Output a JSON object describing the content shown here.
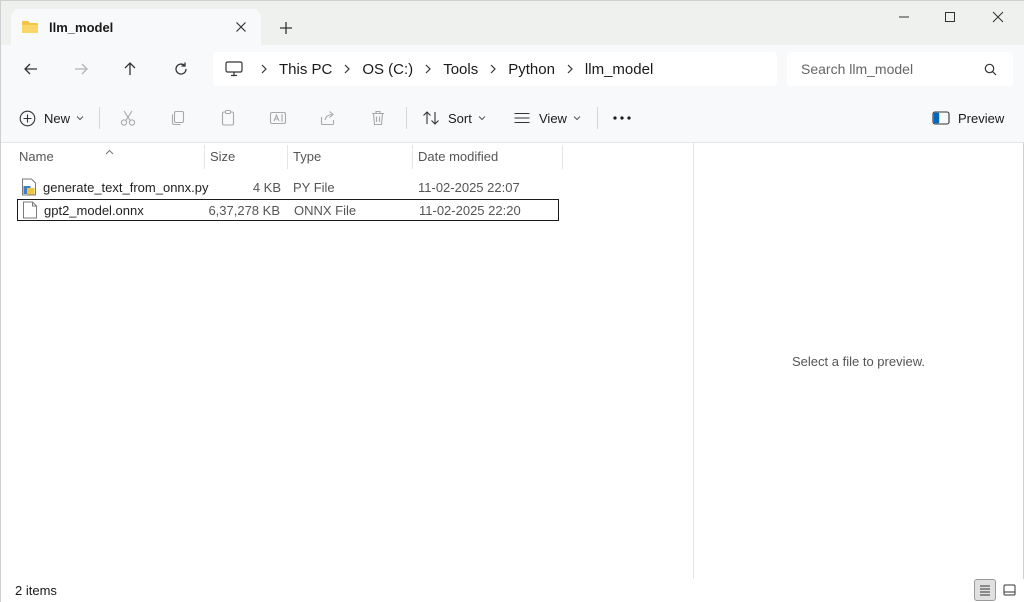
{
  "tab": {
    "title": "llm_model",
    "folder_color": "#f4c542"
  },
  "window_controls": [
    "minimize",
    "maximize",
    "close"
  ],
  "breadcrumb": [
    "This PC",
    "OS (C:)",
    "Tools",
    "Python",
    "llm_model"
  ],
  "search": {
    "placeholder": "Search llm_model"
  },
  "toolbar": {
    "new_label": "New",
    "sort_label": "Sort",
    "view_label": "View",
    "preview_label": "Preview"
  },
  "columns": {
    "name": "Name",
    "size": "Size",
    "type": "Type",
    "date": "Date modified"
  },
  "files": [
    {
      "name": "generate_text_from_onnx.py",
      "size": "4 KB",
      "type": "PY File",
      "date": "11-02-2025 22:07",
      "icon": "python-file-icon"
    },
    {
      "name": "gpt2_model.onnx",
      "size": "6,37,278 KB",
      "type": "ONNX File",
      "date": "11-02-2025 22:20",
      "icon": "generic-file-icon",
      "selected": true
    }
  ],
  "preview_pane": {
    "message": "Select a file to preview."
  },
  "status": {
    "item_count": "2 items"
  },
  "colors": {
    "accent": "#0067c0",
    "chrome": "#eef1ee",
    "toolbar": "#f8f9fa"
  }
}
